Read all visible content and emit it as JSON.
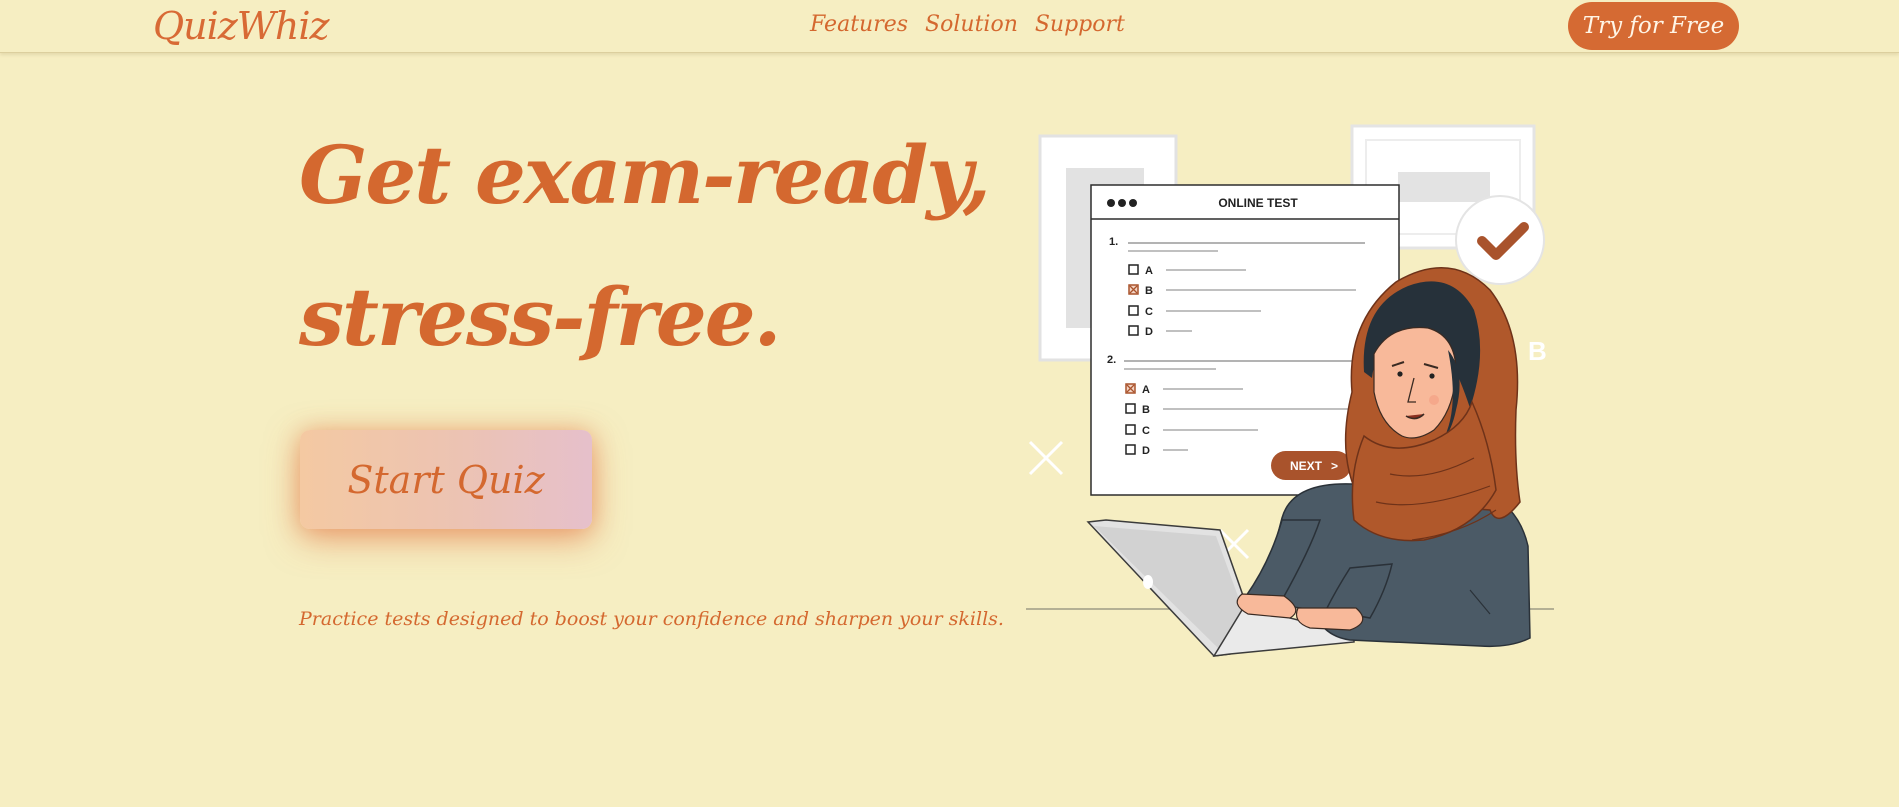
{
  "header": {
    "logo": "QuizWhiz",
    "nav": [
      "Features",
      "Solution",
      "Support"
    ],
    "cta_label": "Try for Free"
  },
  "hero": {
    "title_line1": "Get exam-ready,",
    "title_line2": "stress-free.",
    "button_label": "Start Quiz",
    "tagline": "Practice tests designed to boost your confidence and sharpen your skills."
  },
  "illustration": {
    "window_title": "ONLINE TEST",
    "q1_number": "1.",
    "q2_number": "2.",
    "options": [
      "A",
      "B",
      "C",
      "D"
    ],
    "next_label": "NEXT",
    "next_arrow": ">",
    "deco_letter": "B"
  },
  "colors": {
    "background": "#f6eec2",
    "accent": "#d56a33",
    "scarf": "#b0582b",
    "sweater": "#4b5a66"
  }
}
